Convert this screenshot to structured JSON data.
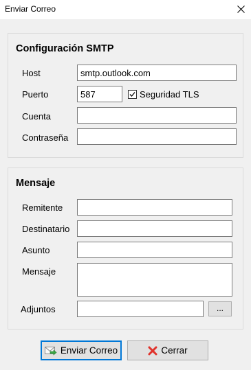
{
  "window": {
    "title": "Enviar Correo",
    "close_icon": "close-icon"
  },
  "smtp": {
    "title": "Configuración SMTP",
    "host_label": "Host",
    "host_value": "smtp.outlook.com",
    "port_label": "Puerto",
    "port_value": "587",
    "tls_label": "Seguridad TLS",
    "tls_checked": true,
    "account_label": "Cuenta",
    "account_value": "",
    "password_label": "Contraseña",
    "password_value": ""
  },
  "message": {
    "title": "Mensaje",
    "sender_label": "Remitente",
    "sender_value": "",
    "recipient_label": "Destinatario",
    "recipient_value": "",
    "subject_label": "Asunto",
    "subject_value": "",
    "body_label": "Mensaje",
    "body_value": "",
    "attachments_label": "Adjuntos",
    "attachments_value": "",
    "browse_label": "..."
  },
  "buttons": {
    "send_label": "Enviar Correo",
    "send_icon": "send-mail-icon",
    "close_label": "Cerrar",
    "close_icon": "red-x-icon"
  },
  "colors": {
    "accent": "#0078d7",
    "close_red": "#e0322b"
  }
}
